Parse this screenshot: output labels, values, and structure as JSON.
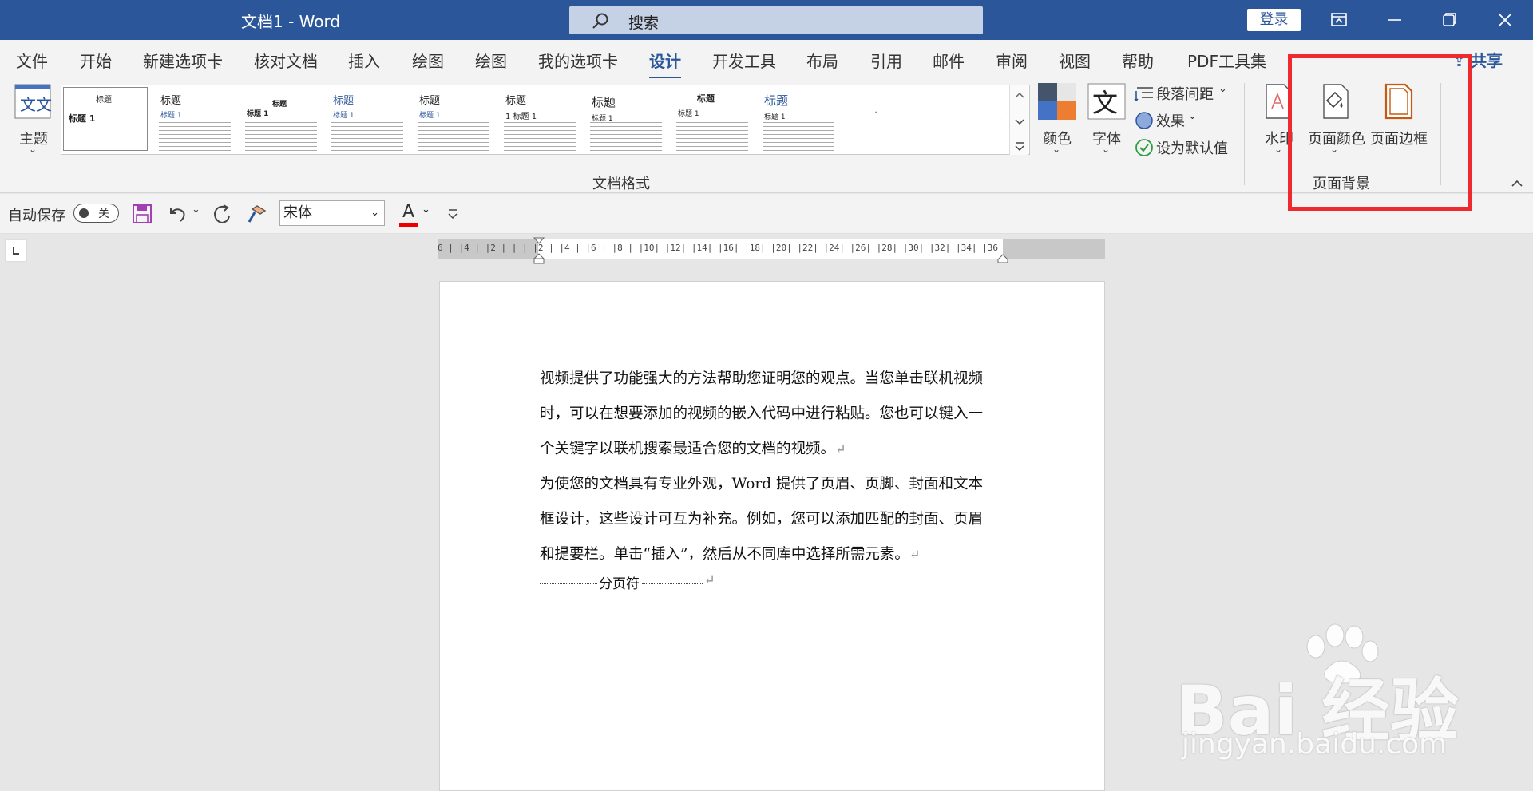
{
  "titlebar": {
    "doc_title": "文档1  -  Word",
    "search_placeholder": "搜索",
    "login_label": "登录"
  },
  "tabs": [
    {
      "label": "文件"
    },
    {
      "label": "开始"
    },
    {
      "label": "新建选项卡"
    },
    {
      "label": "核对文档"
    },
    {
      "label": "插入"
    },
    {
      "label": "绘图"
    },
    {
      "label": "绘图"
    },
    {
      "label": "我的选项卡"
    },
    {
      "label": "设计"
    },
    {
      "label": "开发工具"
    },
    {
      "label": "布局"
    },
    {
      "label": "引用"
    },
    {
      "label": "邮件"
    },
    {
      "label": "审阅"
    },
    {
      "label": "视图"
    },
    {
      "label": "帮助"
    },
    {
      "label": "PDF工具集"
    }
  ],
  "share_label": "共享",
  "ribbon": {
    "theme_label": "主题",
    "theme_icon_text": "文文",
    "gallery": [
      {
        "heading": "标题",
        "sub": "标题 1"
      },
      {
        "heading": "标题",
        "sub": "标题 1"
      },
      {
        "heading": "标题",
        "sub": "标题 1"
      },
      {
        "heading": "标题",
        "sub": "标题 1"
      },
      {
        "heading": "标题",
        "sub": "标题 1"
      },
      {
        "heading": "标题",
        "sub": "1  标题 1"
      },
      {
        "heading": "标题",
        "sub": "标题 1"
      },
      {
        "heading": "标题",
        "sub": "标题 1"
      },
      {
        "heading": "标题",
        "sub": "标题 1"
      }
    ],
    "doc_format_group": "文档格式",
    "colors_label": "颜色",
    "fonts_label": "字体",
    "fonts_icon_text": "文",
    "para_spacing_label": "段落间距",
    "effects_label": "效果",
    "set_default_label": "设为默认值",
    "watermark_label": "水印",
    "page_color_label": "页面颜色",
    "page_border_label": "页面边框",
    "page_bg_group": "页面背景"
  },
  "qat": {
    "autosave_label": "自动保存",
    "toggle_text": "关",
    "font_name": "宋体",
    "font_color_letter": "A"
  },
  "ruler_text": "6 | |4 | |2 | |   | |2 | |4 | |6 | |8 | |10| |12| |14| |16| |18| |20| |22| |24| |26| |28| |30| |32| |34| |36",
  "document": {
    "para1_lines": [
      "视频提供了功能强大的方法帮助您证明您的观点。当您单击联机视频",
      "时，可以在想要添加的视频的嵌入代码中进行粘贴。您也可以键入一",
      "个关键字以联机搜索最适合您的文档的视频。"
    ],
    "para2_lines": [
      "为使您的文档具有专业外观，Word 提供了页眉、页脚、封面和文本",
      "框设计，这些设计可互为补充。例如，您可以添加匹配的封面、页眉",
      "和提要栏。单击“插入”，然后从不同库中选择所需元素。"
    ],
    "page_break_label": "分页符",
    "para_mark": "↵"
  },
  "watermark": {
    "brand": "Bai 经验",
    "url": "jingyan.baidu.com"
  },
  "colors": {
    "title_bar": "#2b579a",
    "highlight": "#ee2a2f"
  }
}
